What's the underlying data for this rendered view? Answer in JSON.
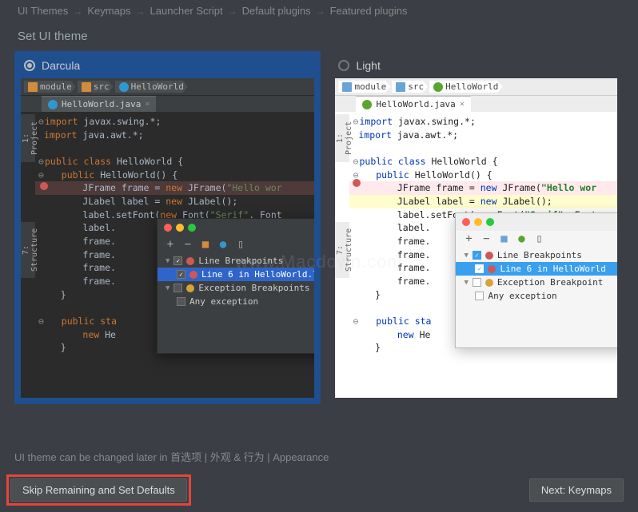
{
  "breadcrumb": {
    "items": [
      "UI Themes",
      "Keymaps",
      "Launcher Script",
      "Default plugins",
      "Featured plugins"
    ]
  },
  "page_title": "Set UI theme",
  "themes": {
    "dark": {
      "label": "Darcula",
      "selected": true
    },
    "light": {
      "label": "Light",
      "selected": false
    }
  },
  "editor": {
    "path_crumbs": [
      "module",
      "src",
      "HelloWorld"
    ],
    "tab_label": "HelloWorld.java",
    "side_tabs": {
      "project": "1: Project",
      "structure": "7: Structure"
    },
    "code_lines": {
      "l1": "import javax.swing.*;",
      "l2": "import java.awt.*;",
      "l3": "",
      "l4_kw": "public class",
      "l4_rest": " HelloWorld {",
      "l5_kw": "public",
      "l5_rest": " HelloWorld() {",
      "l6_a": "JFrame frame = ",
      "l6_kw": "new",
      "l6_b": " JFrame(",
      "l6_str": "\"Hello wor",
      "l7_a": "JLabel label = ",
      "l7_kw": "new",
      "l7_b": " JLabel();",
      "l8_a": "label.setFont(",
      "l8_kw": "new",
      "l8_b": " Font(",
      "l8_str": "\"Serif\"",
      "l8_c": ", Font",
      "l9": "label.",
      "l10": "frame.",
      "l11": "frame.",
      "l12": "frame.",
      "l13": "frame.",
      "l14": "}",
      "l15": "",
      "l16_kw": "public sta",
      "l17_kw": "new",
      "l17_rest": " He",
      "l18": "}"
    }
  },
  "breakpoints_popup": {
    "toolbar_icons": [
      "add",
      "remove",
      "folder",
      "class",
      "copy"
    ],
    "group1": "Line Breakpoints",
    "item1_dark": "Line 6 in HelloWorld.l",
    "item1_light": "Line 6 in HelloWorld",
    "group2_dark": "Exception Breakpoints",
    "group2_light": "Exception Breakpoint",
    "item2": "Any exception"
  },
  "footer": {
    "note": "UI theme can be changed later in 首选项 | 外观 & 行为 | Appearance",
    "skip_button": "Skip Remaining and Set Defaults",
    "next_button": "Next: Keymaps"
  },
  "watermark": "www.Macdown.com"
}
